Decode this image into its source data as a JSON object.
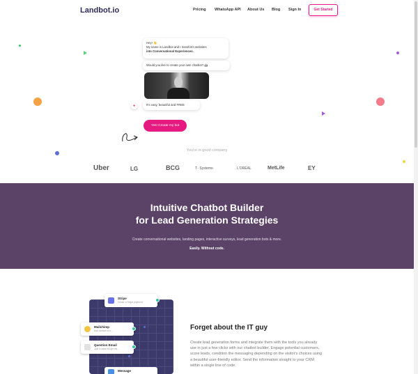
{
  "nav": {
    "logo": "Landbot.io",
    "items": [
      "Pricing",
      "WhatsApp API",
      "About Us",
      "Blog",
      "Sign In"
    ],
    "cta": "Get Started"
  },
  "hero": {
    "greeting_line1": "Hey! 👋",
    "greeting_line2": "My name is Landbot and I transform websites",
    "greeting_line3": "into Conversational Experiences.",
    "question": "Would you like to create your own chatbot? 🤖",
    "answer": "It's easy, beautiful and FREE",
    "button": "Yes! Create my bot",
    "company_label": "You're in good company",
    "brands": [
      "Uber",
      "LG",
      "BCG",
      "T··Systems·",
      "L'ORÉAL",
      "MetLife",
      "EY"
    ]
  },
  "band": {
    "title_line1": "Intuitive Chatbot Builder",
    "title_line2": "for Lead Generation Strategies",
    "subtitle": "Create conversational websites, landing pages, interactive surveys, lead generation bots & more.",
    "easily": "Easily. Without code."
  },
  "integrations": [
    {
      "name": "Stripe",
      "desc": "Create a Stripe payment"
    },
    {
      "name": "Mailchimp",
      "desc": "Add contact to a..."
    },
    {
      "name": "Question Email",
      "desc": "Just in case we get dis..."
    },
    {
      "name": "Message",
      "desc": ""
    }
  ],
  "feature": {
    "title": "Forget about the IT guy",
    "text": "Create lead generation forms and integrate them with the tools you already use in just a few clicks with our chatbot builder. Engage potential customers, score leads, condition the messaging depending on the visitor's choices using a beautiful user-friendly editor. Send the information straight to your CRM within a single line of code."
  },
  "colors": {
    "accent": "#e5197f",
    "band": "#5a4366",
    "logo": "#2e2a5a"
  }
}
